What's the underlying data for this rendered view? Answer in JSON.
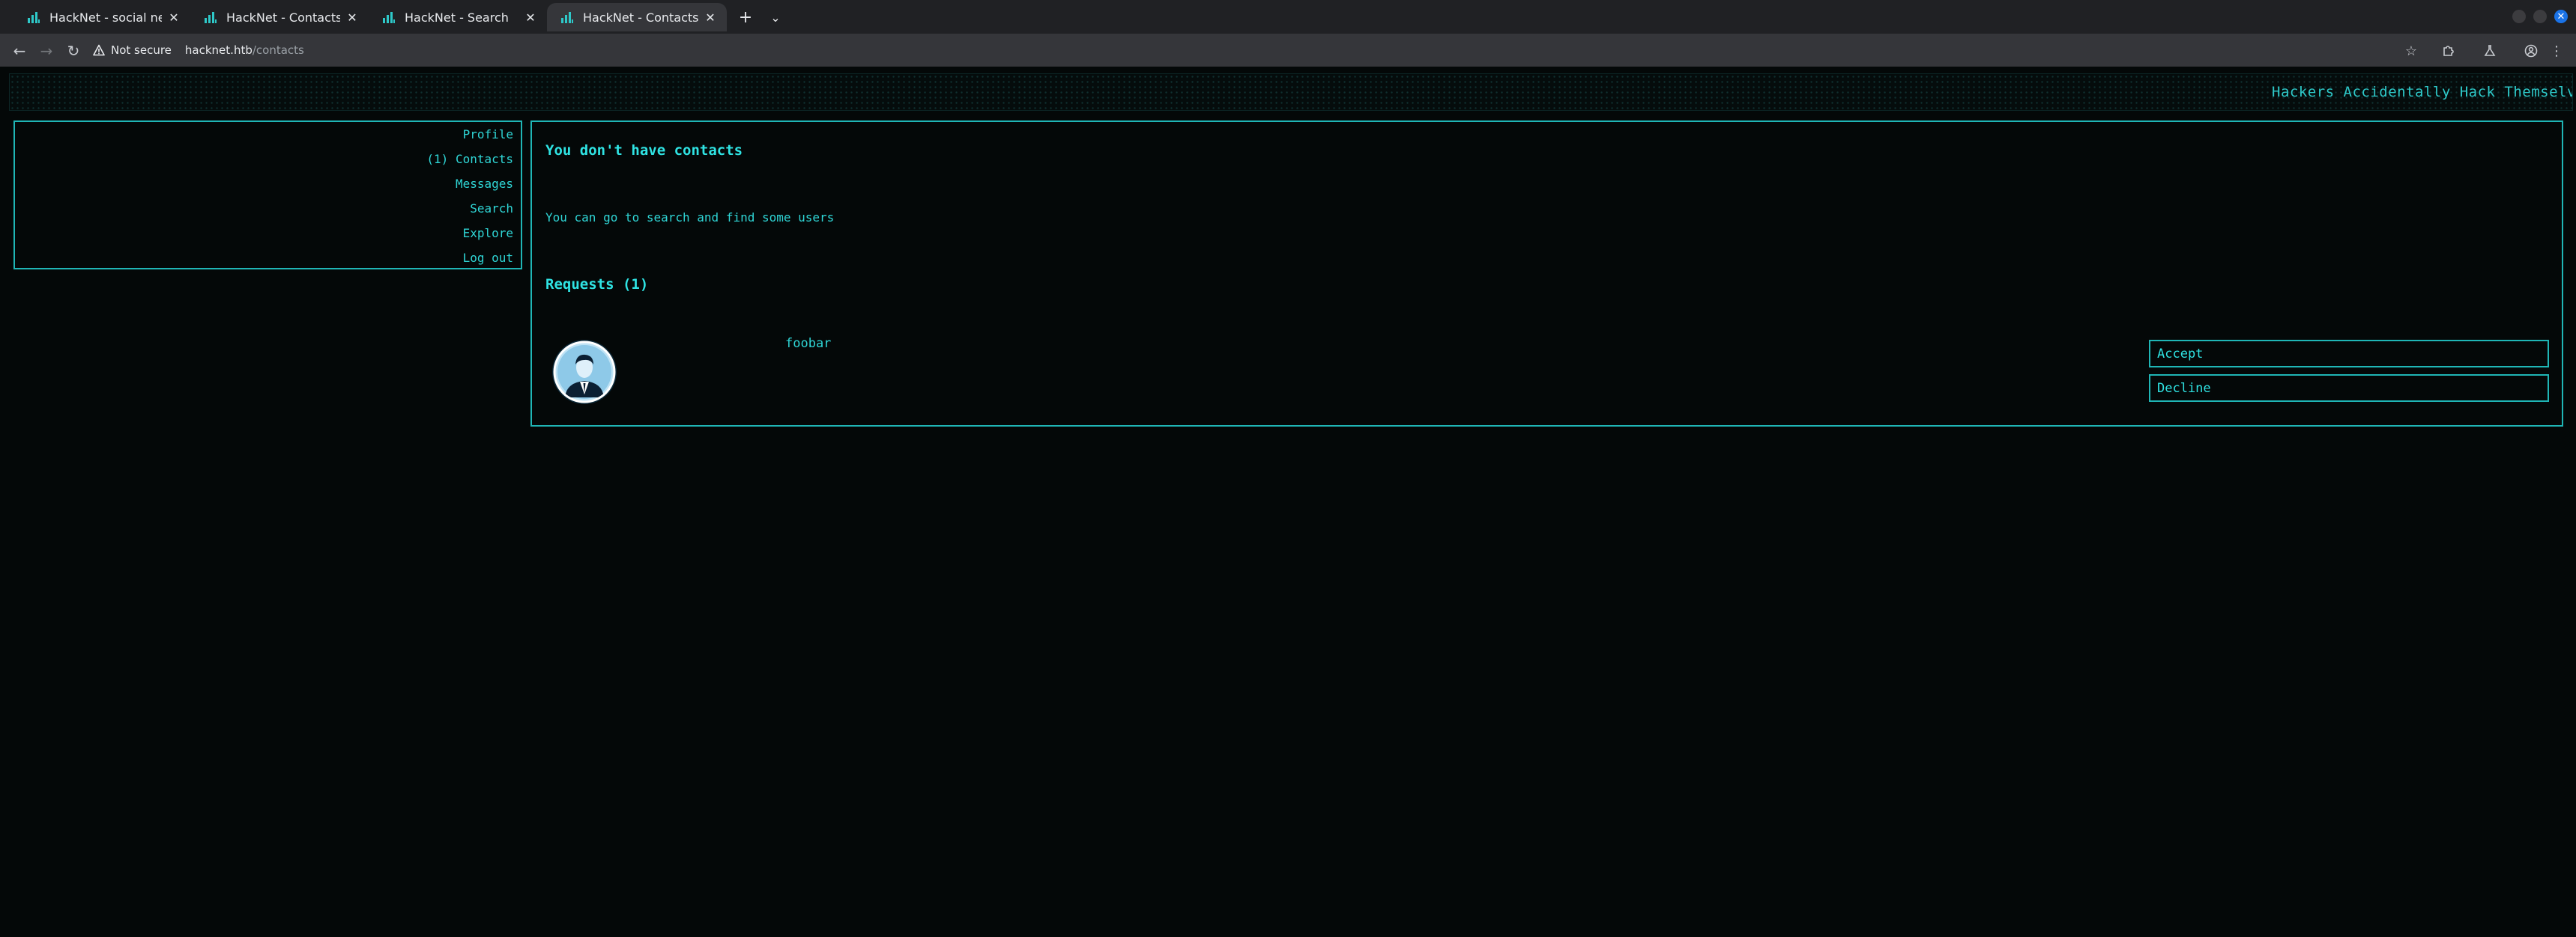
{
  "browser": {
    "tabs": [
      {
        "title": "HackNet - social network",
        "active": false
      },
      {
        "title": "HackNet - Contacts",
        "active": false
      },
      {
        "title": "HackNet - Search",
        "active": false
      },
      {
        "title": "HackNet - Contacts",
        "active": true
      }
    ],
    "security_label": "Not secure",
    "url_host": "hacknet.htb",
    "url_path": "/contacts"
  },
  "ticker": {
    "text": "Hackers Accidentally Hack Themselves, |"
  },
  "sidebar": {
    "items": [
      {
        "label": "Profile"
      },
      {
        "label": "(1) Contacts"
      },
      {
        "label": "Messages"
      },
      {
        "label": "Search"
      },
      {
        "label": "Explore"
      },
      {
        "label": "Log out"
      }
    ]
  },
  "contacts": {
    "empty_title": "You don't have contacts",
    "hint": "You can go to search and find some users",
    "requests_title": "Requests (1)",
    "requests": [
      {
        "username": "foobar",
        "accept_label": "Accept",
        "decline_label": "Decline"
      }
    ]
  },
  "colors": {
    "accent": "#1fb5b5",
    "text": "#2fd6d6",
    "background": "#040808"
  }
}
